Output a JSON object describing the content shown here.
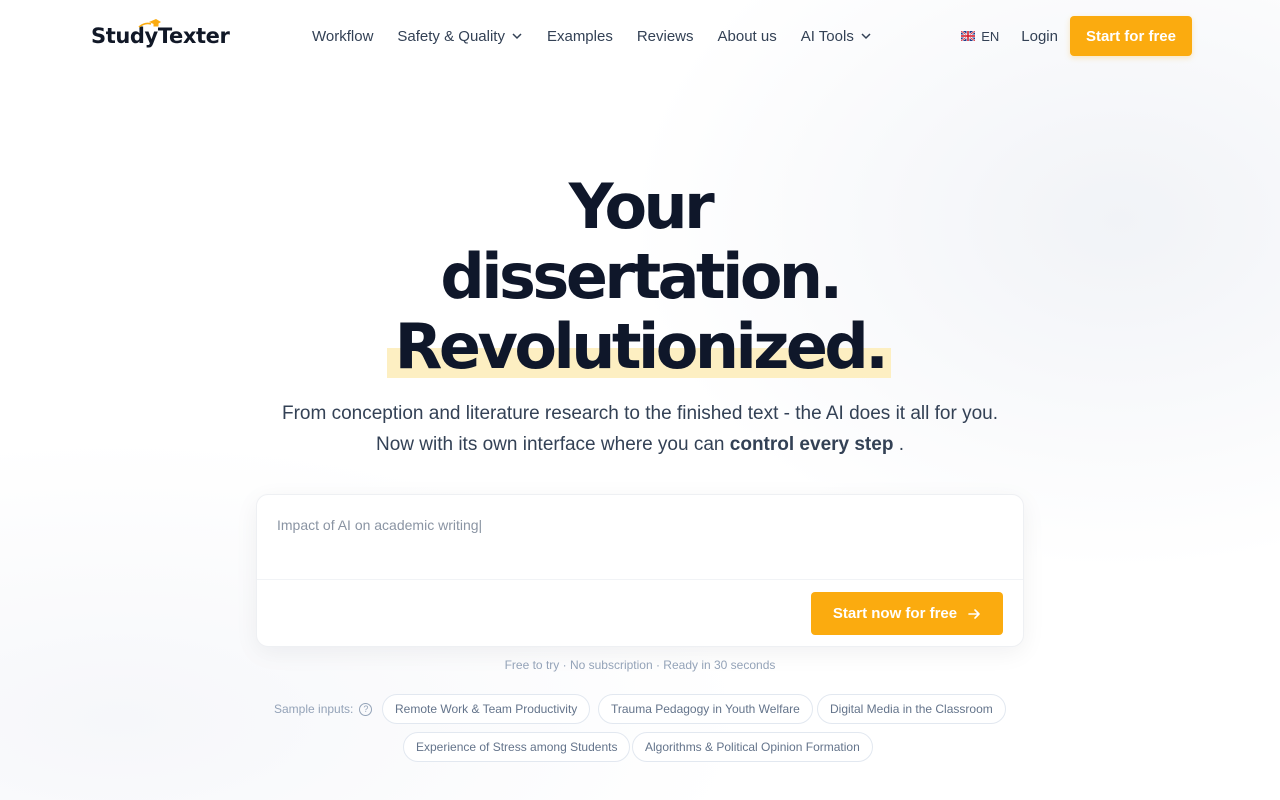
{
  "brand": {
    "name": "StudyTexter"
  },
  "nav": {
    "links": [
      {
        "label": "Workflow",
        "dropdown": false
      },
      {
        "label": "Safety & Quality",
        "dropdown": true
      },
      {
        "label": "Examples",
        "dropdown": false
      },
      {
        "label": "Reviews",
        "dropdown": false
      },
      {
        "label": "About us",
        "dropdown": false
      },
      {
        "label": "AI Tools",
        "dropdown": true
      }
    ],
    "language": "EN",
    "login": "Login",
    "cta": "Start for free"
  },
  "hero": {
    "line1": "Your",
    "line2": "dissertation.",
    "line3": "Revolutionized.",
    "subtitle_line1": "From conception and literature research to the finished text - the AI does it all for you.",
    "subtitle_line2_prefix": "Now with its own interface where you can",
    "subtitle_line2_bold": "control every step",
    "subtitle_line2_suffix": "."
  },
  "input_card": {
    "placeholder": "Impact of AI on academic writing|",
    "button": "Start now for free"
  },
  "tagline": "Free to try · No subscription · Ready in 30 seconds",
  "samples": {
    "label": "Sample inputs:",
    "chips": [
      "Remote Work & Team Productivity",
      "Trauma Pedagogy in Youth Welfare",
      "Digital Media in the Classroom",
      "Experience of Stress among Students",
      "Algorithms & Political Opinion Formation"
    ]
  },
  "colors": {
    "accent": "#fbab0f",
    "highlight": "#fdefc2",
    "heading": "#0f172a",
    "text": "#334155"
  },
  "icons": {
    "flag": "uk-flag-icon",
    "dropdown": "chevron-down-icon",
    "arrow": "arrow-right-icon",
    "help": "help-circle-icon",
    "logo_cap": "graduation-cap-icon"
  }
}
